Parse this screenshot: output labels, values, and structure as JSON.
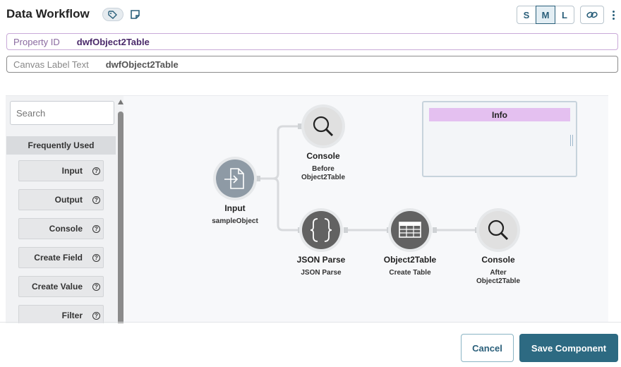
{
  "header": {
    "title": "Data Workflow",
    "sizes": [
      "S",
      "M",
      "L"
    ],
    "active_size": "M"
  },
  "fields": {
    "property_id_label": "Property ID",
    "property_id_value": "dwfObject2Table",
    "canvas_label_label": "Canvas Label Text",
    "canvas_label_value": "dwfObject2Table"
  },
  "palette": {
    "search_placeholder": "Search",
    "section_title": "Frequently Used",
    "items": [
      "Input",
      "Output",
      "Console",
      "Create Field",
      "Create Value",
      "Filter"
    ]
  },
  "nodes": {
    "input": {
      "title": "Input",
      "subtitle": "sampleObject"
    },
    "console_before": {
      "title": "Console",
      "subtitle_1": "Before",
      "subtitle_2": "Object2Table"
    },
    "json_parse": {
      "title": "JSON Parse",
      "subtitle": "JSON Parse"
    },
    "object2table": {
      "title": "Object2Table",
      "subtitle": "Create Table"
    },
    "console_after": {
      "title": "Console",
      "subtitle_1": "After",
      "subtitle_2": "Object2Table"
    }
  },
  "info_box": {
    "title": "Info"
  },
  "footer": {
    "cancel_label": "Cancel",
    "save_label": "Save Component"
  },
  "colors": {
    "accent": "#2d6a82",
    "node_dark": "#626262",
    "node_input": "#8e9aa5",
    "node_console": "#e2e2e2",
    "info_header": "#e4c0f0"
  }
}
